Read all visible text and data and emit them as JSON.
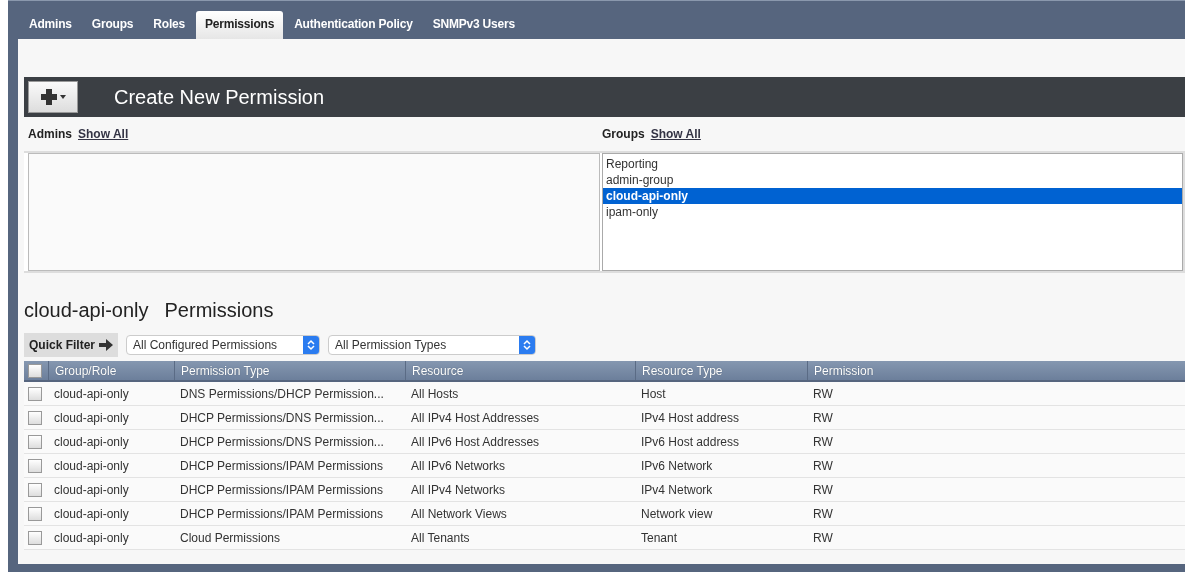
{
  "tabs": [
    {
      "label": "Admins",
      "selected": false
    },
    {
      "label": "Groups",
      "selected": false
    },
    {
      "label": "Roles",
      "selected": false
    },
    {
      "label": "Permissions",
      "selected": true
    },
    {
      "label": "Authentication Policy",
      "selected": false
    },
    {
      "label": "SNMPv3 Users",
      "selected": false
    }
  ],
  "header": {
    "title": "Create New Permission"
  },
  "admins": {
    "label": "Admins",
    "link": "Show All"
  },
  "groups": {
    "label": "Groups",
    "link": "Show All",
    "items": [
      {
        "label": "Reporting",
        "selected": false
      },
      {
        "label": "admin-group",
        "selected": false
      },
      {
        "label": "cloud-api-only",
        "selected": true
      },
      {
        "label": "ipam-only",
        "selected": false
      }
    ]
  },
  "section": {
    "group": "cloud-api-only",
    "title": "Permissions"
  },
  "filter": {
    "label": "Quick Filter",
    "selects": [
      "All Configured Permissions",
      "All Permission Types"
    ]
  },
  "table": {
    "header_checked": false,
    "columns": [
      "Group/Role",
      "Permission Type",
      "Resource",
      "Resource Type",
      "Permission"
    ],
    "rows": [
      {
        "checked": false,
        "cells": [
          "cloud-api-only",
          "DNS Permissions/DHCP Permission...",
          "All Hosts",
          "Host",
          "RW"
        ]
      },
      {
        "checked": false,
        "cells": [
          "cloud-api-only",
          "DHCP Permissions/DNS Permission...",
          "All IPv4 Host Addresses",
          "IPv4 Host address",
          "RW"
        ]
      },
      {
        "checked": false,
        "cells": [
          "cloud-api-only",
          "DHCP Permissions/DNS Permission...",
          "All IPv6 Host Addresses",
          "IPv6 Host address",
          "RW"
        ]
      },
      {
        "checked": false,
        "cells": [
          "cloud-api-only",
          "DHCP Permissions/IPAM Permissions",
          "All IPv6 Networks",
          "IPv6 Network",
          "RW"
        ]
      },
      {
        "checked": false,
        "cells": [
          "cloud-api-only",
          "DHCP Permissions/IPAM Permissions",
          "All IPv4 Networks",
          "IPv4 Network",
          "RW"
        ]
      },
      {
        "checked": false,
        "cells": [
          "cloud-api-only",
          "DHCP Permissions/IPAM Permissions",
          "All Network Views",
          "Network view",
          "RW"
        ]
      },
      {
        "checked": false,
        "cells": [
          "cloud-api-only",
          "Cloud Permissions",
          "All Tenants",
          "Tenant",
          "RW"
        ]
      }
    ]
  }
}
